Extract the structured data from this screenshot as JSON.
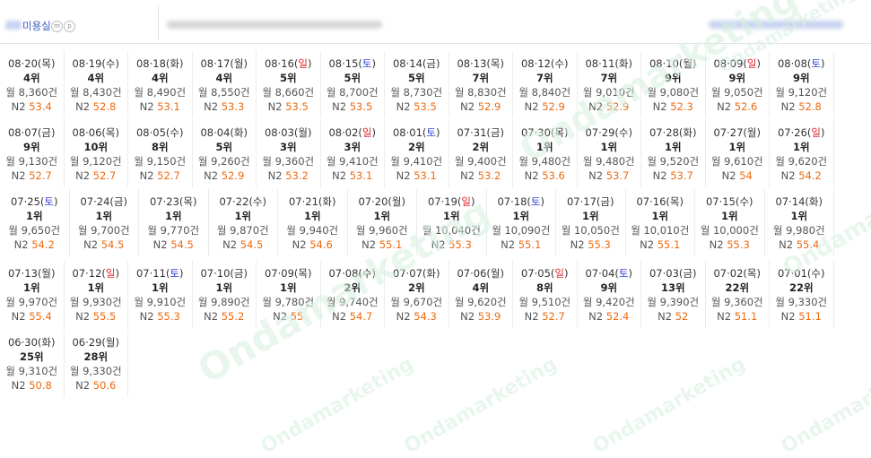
{
  "header": {
    "shop_name": "미용실",
    "badge_m": "m",
    "badge_p": "p"
  },
  "watermark": "Ondamarketing",
  "colors": {
    "saturday": "#2c3fd6",
    "sunday": "#e2232a",
    "n2_value": "#ee6a10"
  },
  "rows": [
    {
      "cells": [
        {
          "md": "08·20",
          "wk": "목",
          "rank": "4위",
          "month": "월 8,360건",
          "n2": "53.4"
        },
        {
          "md": "08·19",
          "wk": "수",
          "rank": "4위",
          "month": "월 8,430건",
          "n2": "52.8"
        },
        {
          "md": "08·18",
          "wk": "화",
          "rank": "4위",
          "month": "월 8,490건",
          "n2": "53.1"
        },
        {
          "md": "08·17",
          "wk": "월",
          "rank": "4위",
          "month": "월 8,550건",
          "n2": "53.3"
        },
        {
          "md": "08·16",
          "wk": "일",
          "rank": "5위",
          "month": "월 8,660건",
          "n2": "53.5"
        },
        {
          "md": "08·15",
          "wk": "토",
          "rank": "5위",
          "month": "월 8,700건",
          "n2": "53.5"
        },
        {
          "md": "08·14",
          "wk": "금",
          "rank": "5위",
          "month": "월 8,730건",
          "n2": "53.5"
        },
        {
          "md": "08·13",
          "wk": "목",
          "rank": "7위",
          "month": "월 8,830건",
          "n2": "52.9"
        },
        {
          "md": "08·12",
          "wk": "수",
          "rank": "7위",
          "month": "월 8,840건",
          "n2": "52.9"
        },
        {
          "md": "08·11",
          "wk": "화",
          "rank": "7위",
          "month": "월 9,010건",
          "n2": "52.9"
        },
        {
          "md": "08·10",
          "wk": "월",
          "rank": "9위",
          "month": "월 9,080건",
          "n2": "52.3"
        },
        {
          "md": "08·09",
          "wk": "일",
          "rank": "9위",
          "month": "월 9,050건",
          "n2": "52.6"
        },
        {
          "md": "08·08",
          "wk": "토",
          "rank": "9위",
          "month": "월 9,120건",
          "n2": "52.8"
        }
      ]
    },
    {
      "cells": [
        {
          "md": "08·07",
          "wk": "금",
          "rank": "9위",
          "month": "월 9,130건",
          "n2": "52.7"
        },
        {
          "md": "08·06",
          "wk": "목",
          "rank": "10위",
          "month": "월 9,120건",
          "n2": "52.7"
        },
        {
          "md": "08·05",
          "wk": "수",
          "rank": "8위",
          "month": "월 9,150건",
          "n2": "52.7"
        },
        {
          "md": "08·04",
          "wk": "화",
          "rank": "5위",
          "month": "월 9,260건",
          "n2": "52.9"
        },
        {
          "md": "08·03",
          "wk": "월",
          "rank": "3위",
          "month": "월 9,360건",
          "n2": "53.2"
        },
        {
          "md": "08·02",
          "wk": "일",
          "rank": "3위",
          "month": "월 9,410건",
          "n2": "53.1"
        },
        {
          "md": "08·01",
          "wk": "토",
          "rank": "2위",
          "month": "월 9,410건",
          "n2": "53.1"
        },
        {
          "md": "07·31",
          "wk": "금",
          "rank": "2위",
          "month": "월 9,400건",
          "n2": "53.2"
        },
        {
          "md": "07·30",
          "wk": "목",
          "rank": "1위",
          "month": "월 9,480건",
          "n2": "53.6"
        },
        {
          "md": "07·29",
          "wk": "수",
          "rank": "1위",
          "month": "월 9,480건",
          "n2": "53.7"
        },
        {
          "md": "07·28",
          "wk": "화",
          "rank": "1위",
          "month": "월 9,520건",
          "n2": "53.7"
        },
        {
          "md": "07·27",
          "wk": "월",
          "rank": "1위",
          "month": "월 9,610건",
          "n2": "54"
        },
        {
          "md": "07·26",
          "wk": "일",
          "rank": "1위",
          "month": "월 9,620건",
          "n2": "54.2"
        }
      ]
    },
    {
      "cells": [
        {
          "md": "07·25",
          "wk": "토",
          "rank": "1위",
          "month": "월 9,650건",
          "n2": "54.2"
        },
        {
          "md": "07·24",
          "wk": "금",
          "rank": "1위",
          "month": "월 9,700건",
          "n2": "54.5"
        },
        {
          "md": "07·23",
          "wk": "목",
          "rank": "1위",
          "month": "월 9,770건",
          "n2": "54.5"
        },
        {
          "md": "07·22",
          "wk": "수",
          "rank": "1위",
          "month": "월 9,870건",
          "n2": "54.5"
        },
        {
          "md": "07·21",
          "wk": "화",
          "rank": "1위",
          "month": "월 9,940건",
          "n2": "54.6"
        },
        {
          "md": "07·20",
          "wk": "월",
          "rank": "1위",
          "month": "월 9,960건",
          "n2": "55.1"
        },
        {
          "md": "07·19",
          "wk": "일",
          "rank": "1위",
          "month": "월 10,040건",
          "n2": "55.3"
        },
        {
          "md": "07·18",
          "wk": "토",
          "rank": "1위",
          "month": "월 10,090건",
          "n2": "55.1"
        },
        {
          "md": "07·17",
          "wk": "금",
          "rank": "1위",
          "month": "월 10,050건",
          "n2": "55.3"
        },
        {
          "md": "07·16",
          "wk": "목",
          "rank": "1위",
          "month": "월 10,010건",
          "n2": "55.1"
        },
        {
          "md": "07·15",
          "wk": "수",
          "rank": "1위",
          "month": "월 10,000건",
          "n2": "55.3"
        },
        {
          "md": "07·14",
          "wk": "화",
          "rank": "1위",
          "month": "월 9,980건",
          "n2": "55.4"
        }
      ]
    },
    {
      "cells": [
        {
          "md": "07·13",
          "wk": "월",
          "rank": "1위",
          "month": "월 9,970건",
          "n2": "55.4"
        },
        {
          "md": "07·12",
          "wk": "일",
          "rank": "1위",
          "month": "월 9,930건",
          "n2": "55.5"
        },
        {
          "md": "07·11",
          "wk": "토",
          "rank": "1위",
          "month": "월 9,910건",
          "n2": "55.3"
        },
        {
          "md": "07·10",
          "wk": "금",
          "rank": "1위",
          "month": "월 9,890건",
          "n2": "55.2"
        },
        {
          "md": "07·09",
          "wk": "목",
          "rank": "1위",
          "month": "월 9,780건",
          "n2": "55"
        },
        {
          "md": "07·08",
          "wk": "수",
          "rank": "2위",
          "month": "월 9,740건",
          "n2": "54.7"
        },
        {
          "md": "07·07",
          "wk": "화",
          "rank": "2위",
          "month": "월 9,670건",
          "n2": "54.3"
        },
        {
          "md": "07·06",
          "wk": "월",
          "rank": "4위",
          "month": "월 9,620건",
          "n2": "53.9"
        },
        {
          "md": "07·05",
          "wk": "일",
          "rank": "8위",
          "month": "월 9,510건",
          "n2": "52.7"
        },
        {
          "md": "07·04",
          "wk": "토",
          "rank": "9위",
          "month": "월 9,420건",
          "n2": "52.4"
        },
        {
          "md": "07·03",
          "wk": "금",
          "rank": "13위",
          "month": "월 9,390건",
          "n2": "52"
        },
        {
          "md": "07·02",
          "wk": "목",
          "rank": "22위",
          "month": "월 9,360건",
          "n2": "51.1"
        },
        {
          "md": "07·01",
          "wk": "수",
          "rank": "22위",
          "month": "월 9,330건",
          "n2": "51.1"
        }
      ]
    },
    {
      "cells": [
        {
          "md": "06·30",
          "wk": "화",
          "rank": "25위",
          "month": "월 9,310건",
          "n2": "50.8"
        },
        {
          "md": "06·29",
          "wk": "월",
          "rank": "28위",
          "month": "월 9,330건",
          "n2": "50.6"
        }
      ]
    }
  ]
}
